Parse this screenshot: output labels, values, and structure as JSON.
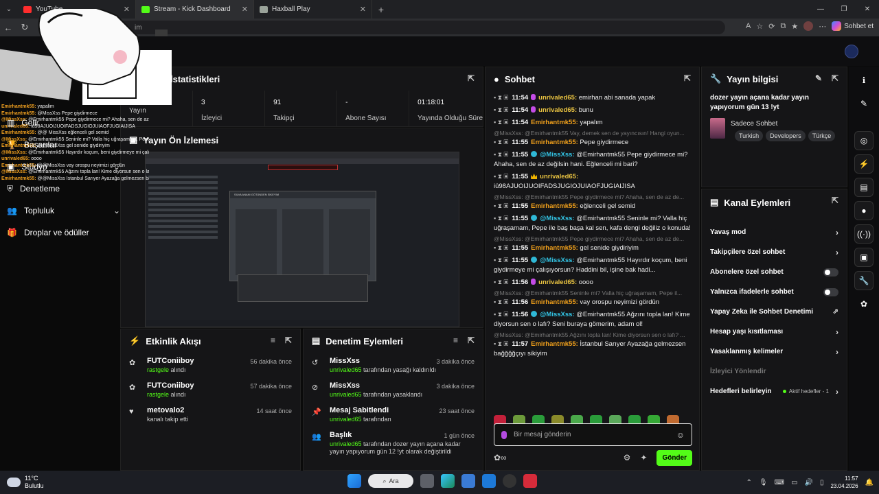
{
  "browser": {
    "tabs": [
      {
        "label": "YouTube",
        "color": "#ff2d2d"
      },
      {
        "label": "Stream - Kick Dashboard",
        "color": "#53fc18"
      },
      {
        "label": "Haxball Play",
        "color": "#9aa39a"
      }
    ],
    "url_fragment": "im",
    "copilot_label": "Sohbet et"
  },
  "overlay": {
    "nav": [
      {
        "label": "Gelir"
      },
      {
        "label": "Başarılar"
      },
      {
        "label": "Stüdyo"
      },
      {
        "label": "Denetleme"
      },
      {
        "label": "Topluluk"
      },
      {
        "label": "Droplar ve ödüller"
      }
    ],
    "chat_lines": [
      {
        "user": "Emirhantmk55:",
        "text": "yapalim"
      },
      {
        "user": "Emirhantmk55:",
        "text": "@MissXss Pepe giydirmece"
      },
      {
        "user": "@MissXss:",
        "text": "@Emirhantmk55 Pepe giydirmece mi? Ahaha, sen de az değilsin hani. Eğlenceli mi bari?"
      },
      {
        "user": "unrivaled65:",
        "text": "iü98AJUOIJUOIFADSJUGIOJUIAOFJUGIAIJISA"
      },
      {
        "user": "Emirhantmk55:",
        "text": "@@ MissXss eğlenceli gel semid"
      },
      {
        "user": "@MissXss:",
        "text": "@Emirhantmk55 Seninle mi? Valla hiç uğraşamam, Pepe ile baş başa kal sen, kafa dengi değiliz o konuda!"
      },
      {
        "user": "Emirhantmk55:",
        "text": "@@MissXss gel senide giydiriyim"
      },
      {
        "user": "@MissXss:",
        "text": "@Emirhantmk55 Hayırdır koçum, beni giydirmeye mi çalışıyorsun?"
      },
      {
        "user": "unrivaled65:",
        "text": "oooo"
      },
      {
        "user": "Emirhantmk55:",
        "text": "@@MissXss vay orospu neyimizi gördün"
      },
      {
        "user": "@MissXss:",
        "text": "@Emirhantmk55 Ağzını topla lan! Kime diyorsun sen o lafı? Seni buraya gömerim, adam ol!"
      },
      {
        "user": "Emirhantmk55:",
        "text": "@@MissXss İstanbul Sarıyer Ayazağa gelmezsen bağğğğçıyı sikiyim"
      }
    ]
  },
  "stats": {
    "title": "İstatistikleri",
    "items": [
      {
        "value": "",
        "label": "Yayın"
      },
      {
        "value": "3",
        "label": "İzleyici"
      },
      {
        "value": "91",
        "label": "Takipçi"
      },
      {
        "value": "-",
        "label": "Abone Sayısı"
      },
      {
        "value": "01:18:01",
        "label": "Yayında Olduğu Süre"
      }
    ]
  },
  "preview": {
    "title": "Yayın Ön İzlemesi",
    "game_title": "SILVA ANANI GÖTÜNDEN SİKEYİM"
  },
  "feed": {
    "title": "Etkinlik Akışı",
    "items": [
      {
        "name": "FUTConiiboy",
        "sub_green": "rastgele",
        "sub": " alındı",
        "time": "56 dakika önce"
      },
      {
        "name": "FUTConiiboy",
        "sub_green": "rastgele",
        "sub": " alındı",
        "time": "57 dakika önce"
      },
      {
        "name": "metovalo2",
        "sub_green": "",
        "sub": "kanalı takip etti",
        "time": "14 saat önce"
      }
    ]
  },
  "moderation": {
    "title": "Denetim Eylemleri",
    "items": [
      {
        "name": "MissXss",
        "sub_green": "unrivaled65",
        "sub": " tarafından yasağı kaldırıldı",
        "time": "3 dakika önce"
      },
      {
        "name": "MissXss",
        "sub_green": "unrivaled65",
        "sub": " tarafından yasaklandı",
        "time": "3 dakika önce"
      },
      {
        "name": "Mesaj Sabitlendi",
        "sub_green": "unrivaled65",
        "sub": " tarafından",
        "time": "23 saat önce"
      },
      {
        "name": "Başlık",
        "sub_green": "unrivaled65",
        "sub": " tarafından dozer yayın açana kadar yayın yapıyorum gün 12 !yt olarak değiştirildi",
        "time": "1 gün önce"
      }
    ]
  },
  "chat": {
    "title": "Sohbet",
    "messages": [
      {
        "reply": "",
        "time": "11:54",
        "user": "unrivaled65:",
        "ucls": "u-y",
        "badge": "p",
        "text": " emirhan abi sanada yapak"
      },
      {
        "reply": "",
        "time": "11:54",
        "user": "unrivaled65:",
        "ucls": "u-y",
        "badge": "p",
        "text": " bunu"
      },
      {
        "reply": "",
        "time": "11:54",
        "user": "Emirhantmk55:",
        "ucls": "u-o",
        "badge": "",
        "text": " yapalım"
      },
      {
        "reply": "@MissXss: @Emirhantmk55 Vay, demek sen de yayıncısın! Hangi oyun...",
        "time": "11:55",
        "user": "Emirhantmk55:",
        "ucls": "u-o",
        "badge": "",
        "text": " Pepe giydirmece"
      },
      {
        "reply": "",
        "time": "11:55",
        "user": "@MissXss:",
        "ucls": "u-b",
        "badge": "r",
        "text": " @Emirhantmk55 Pepe giydirmece mi? Ahaha, sen de az değilsin hani. Eğlenceli mi bari?"
      },
      {
        "reply": "",
        "time": "11:55",
        "user": "unrivaled65:",
        "ucls": "u-y",
        "badge": "c",
        "text": " iü98AJUOIJUOIFADSJUGIOJUIAOFJUGIAIJISA"
      },
      {
        "reply": "@MissXss: @Emirhantmk55 Pepe giydirmece mi? Ahaha, sen de az de...",
        "time": "11:55",
        "user": "Emirhantmk55:",
        "ucls": "u-o",
        "badge": "",
        "text": " eğlenceli gel semid"
      },
      {
        "reply": "",
        "time": "11:55",
        "user": "@MissXss:",
        "ucls": "u-b",
        "badge": "r",
        "text": " @Emirhantmk55 Seninle mi? Valla hiç uğraşamam, Pepe ile baş başa kal sen, kafa dengi değiliz o konuda!"
      },
      {
        "reply": "@MissXss: @Emirhantmk55 Pepe giydirmece mi? Ahaha, sen de az de...",
        "time": "11:55",
        "user": "Emirhantmk55:",
        "ucls": "u-o",
        "badge": "",
        "text": " gel senide giydiriyim"
      },
      {
        "reply": "",
        "time": "11:55",
        "user": "@MissXss:",
        "ucls": "u-b",
        "badge": "r",
        "text": " @Emirhantmk55 Hayırdır koçum, beni giydirmeye mi çalışıyorsun? Haddini bil, işine bak hadi..."
      },
      {
        "reply": "",
        "time": "11:56",
        "user": "unrivaled65:",
        "ucls": "u-y",
        "badge": "p",
        "text": " oooo"
      },
      {
        "reply": "@MissXss: @Emirhantmk55 Seninle mi? Valla hiç uğraşamam, Pepe il...",
        "time": "11:56",
        "user": "Emirhantmk55:",
        "ucls": "u-o",
        "badge": "",
        "text": " vay orospu neyimizi gördün"
      },
      {
        "reply": "",
        "time": "11:56",
        "user": "@MissXss:",
        "ucls": "u-b",
        "badge": "r",
        "text": " @Emirhantmk55 Ağzını topla lan! Kime diyorsun sen o lafı? Seni buraya gömerim, adam ol!"
      },
      {
        "reply": "@MissXss: @Emirhantmk55 Ağzını topla lan! Kime diyorsun sen o lafı? ...",
        "time": "11:57",
        "user": "Emirhantmk55:",
        "ucls": "u-o",
        "badge": "",
        "text": " İstanbul Sarıyer Ayazağa gelmezsen bağğğğçıyı sikiyim"
      }
    ],
    "input_placeholder": "Bir mesaj gönderin",
    "send_label": "Gönder"
  },
  "info": {
    "title": "Yayın bilgisi",
    "stream_title": "dozer yayın açana kadar yayın yapıyorum gün 13 !yt",
    "category": "Sadece Sohbet",
    "tags": [
      "Turkish",
      "Developers",
      "Türkçe"
    ]
  },
  "actions": {
    "title": "Kanal Eylemleri",
    "items": [
      {
        "label": "Yavaş mod",
        "kind": "chev"
      },
      {
        "label": "Takipçilere özel sohbet",
        "kind": "chev"
      },
      {
        "label": "Abonelere özel sohbet",
        "kind": "toggle"
      },
      {
        "label": "Yalnızca ifadelerle sohbet",
        "kind": "toggle"
      },
      {
        "label": "Yapay Zeka ile Sohbet Denetimi",
        "kind": "ext"
      },
      {
        "label": "Hesap yaşı kısıtlaması",
        "kind": "chev"
      },
      {
        "label": "Yasaklanmış kelimeler",
        "kind": "chev"
      },
      {
        "label": "İzleyici Yönlendir",
        "kind": "dim"
      },
      {
        "label": "Hedefleri belirleyin",
        "kind": "goal"
      }
    ],
    "goal_tag": "Aktif hedefler - 1"
  },
  "taskbar": {
    "temp": "11°C",
    "weather": "Bulutlu",
    "search_label": "Ara",
    "time": "11:57",
    "date": "23.04.2026",
    "notif_count": "1"
  }
}
